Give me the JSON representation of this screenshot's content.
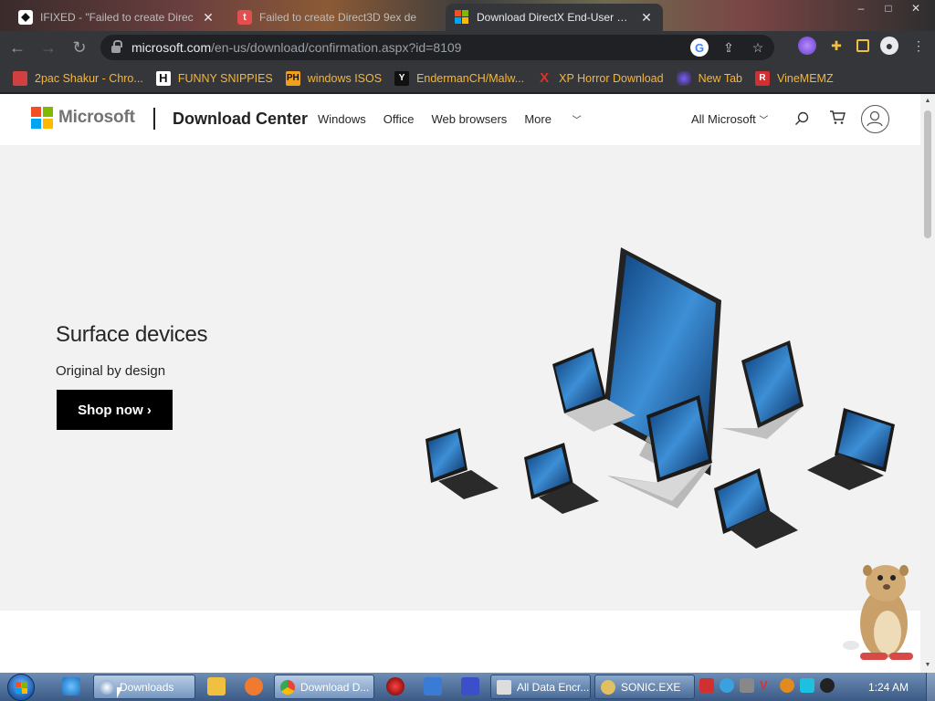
{
  "browser": {
    "tabs": [
      {
        "title": "IFIXED - \"Failed to create Direc",
        "icon": "black-diamond-icon"
      },
      {
        "title": "Failed to create Direct3D 9ex de",
        "icon": "t-icon"
      },
      {
        "title": "Download DirectX End-User Run",
        "icon": "microsoft-icon"
      }
    ],
    "window_controls": [
      "–",
      "□",
      "✕"
    ],
    "url_domain": "microsoft.com",
    "url_path": "/en-us/download/confirmation.aspx?id=8109",
    "bookmarks": [
      {
        "label": "2pac Shakur - Chro...",
        "icon": "calendar-icon"
      },
      {
        "label": "FUNNY SNIPPIES",
        "icon": "h-icon"
      },
      {
        "label": "windows ISOS",
        "icon": "ph-icon"
      },
      {
        "label": "EndermanCH/Malw...",
        "icon": "y-icon"
      },
      {
        "label": "XP Horror Download",
        "icon": "x-icon"
      },
      {
        "label": "New Tab",
        "icon": "globe-icon"
      },
      {
        "label": "VineMEMZ",
        "icon": "r-icon"
      }
    ]
  },
  "site": {
    "brand": "Microsoft",
    "title": "Download Center",
    "nav": [
      "Windows",
      "Office",
      "Web browsers",
      "More"
    ],
    "all_microsoft": "All Microsoft",
    "hero": {
      "title": "Surface devices",
      "subtitle": "Original by design",
      "button": "Shop now"
    }
  },
  "taskbar": {
    "buttons": [
      {
        "label": "Downloads"
      },
      {
        "label": "Download D..."
      },
      {
        "label": "All Data Encr..."
      },
      {
        "label": "SONIC.EXE"
      }
    ],
    "clock": "1:24 AM"
  }
}
